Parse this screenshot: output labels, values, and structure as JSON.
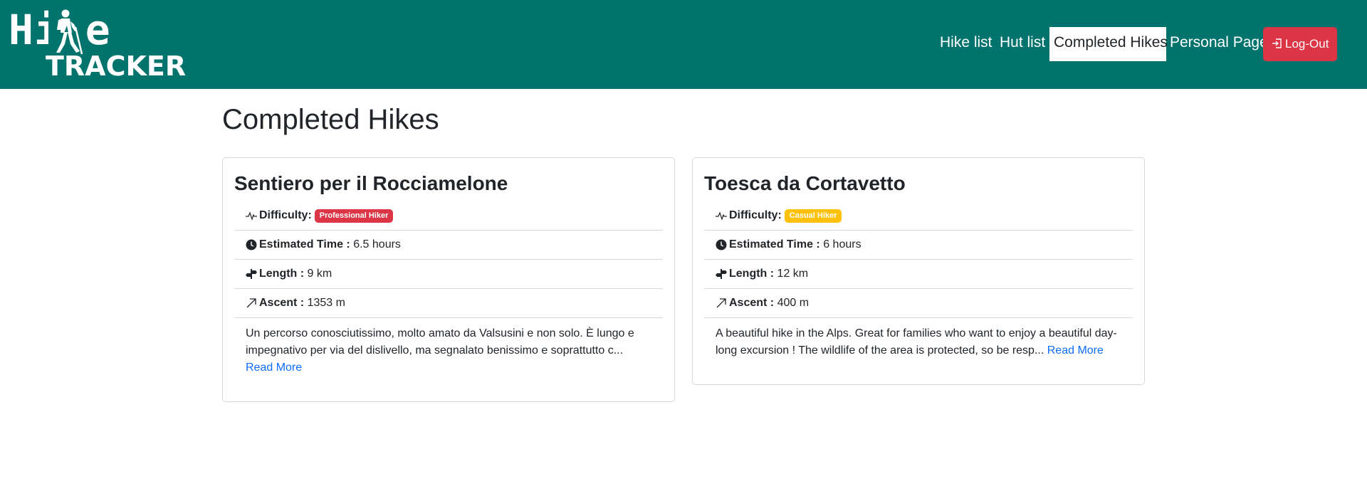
{
  "navbar": {
    "logo": {
      "line1": "Hike",
      "line2": "TRACKER"
    },
    "links": [
      {
        "label": "Hike list",
        "active": false
      },
      {
        "label": "Hut list",
        "active": false
      },
      {
        "label": "Completed Hikes",
        "active": true
      },
      {
        "label": "Personal Page",
        "active": false
      }
    ],
    "logout_label": "Log-Out",
    "colors": {
      "bar": "#00736d",
      "logout": "#dc3545"
    }
  },
  "main": {
    "title": "Completed Hikes",
    "hikes": [
      {
        "title": "Sentiero per il Rocciamelone",
        "difficulty_label": "Difficulty:",
        "difficulty": "Professional Hiker",
        "difficulty_color": "#dc3545",
        "time_label": "Estimated Time :",
        "time": "6.5 hours",
        "length_label": "Length :",
        "length": "9 km",
        "ascent_label": "Ascent :",
        "ascent": "1353 m",
        "description": "Un percorso conosciutissimo, molto amato da Valsusini e non solo. È lungo e impegnativo per via del dislivello, ma segnalato benissimo e soprattutto c...",
        "read_more": "Read More"
      },
      {
        "title": "Toesca da Cortavetto",
        "difficulty_label": "Difficulty:",
        "difficulty": "Casual Hiker",
        "difficulty_color": "#ffc107",
        "time_label": "Estimated Time :",
        "time": "6 hours",
        "length_label": "Length :",
        "length": "12 km",
        "ascent_label": "Ascent :",
        "ascent": "400 m",
        "description": "A beautiful hike in the Alps. Great for families who want to enjoy a beautiful day-long excursion ! The wildlife of the area is protected, so be resp...",
        "read_more": "Read More"
      }
    ]
  }
}
